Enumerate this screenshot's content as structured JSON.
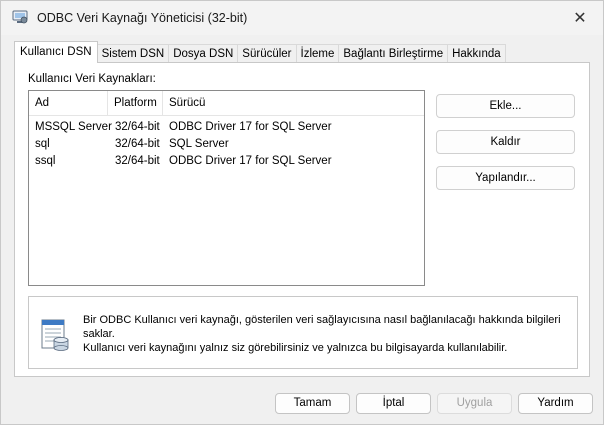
{
  "window": {
    "title": "ODBC Veri Kaynağı Yöneticisi (32-bit)",
    "close_glyph": "✕",
    "background_fragments": [
      "3",
      "Y"
    ]
  },
  "tabs": [
    {
      "label": "Kullanıcı DSN",
      "active": true
    },
    {
      "label": "Sistem DSN",
      "active": false
    },
    {
      "label": "Dosya DSN",
      "active": false
    },
    {
      "label": "Sürücüler",
      "active": false
    },
    {
      "label": "İzleme",
      "active": false
    },
    {
      "label": "Bağlantı Birleştirme",
      "active": false
    },
    {
      "label": "Hakkında",
      "active": false
    }
  ],
  "user_dsn": {
    "section_label": "Kullanıcı Veri Kaynakları:",
    "columns": [
      "Ad",
      "Platform",
      "Sürücü"
    ],
    "rows": [
      {
        "name": "MSSQL Server",
        "platform": "32/64-bit",
        "driver": "ODBC Driver 17 for SQL Server"
      },
      {
        "name": "sql",
        "platform": "32/64-bit",
        "driver": "SQL Server"
      },
      {
        "name": "ssql",
        "platform": "32/64-bit",
        "driver": "ODBC Driver 17 for SQL Server"
      }
    ],
    "buttons": {
      "add": "Ekle...",
      "remove": "Kaldır",
      "configure": "Yapılandır..."
    },
    "info": {
      "line1": "Bir ODBC Kullanıcı veri kaynağı, gösterilen veri sağlayıcısına nasıl bağlanılacağı hakkında bilgileri saklar.",
      "line2": "Kullanıcı veri kaynağını yalnız siz görebilirsiniz ve yalnızca bu bilgisayarda kullanılabilir."
    }
  },
  "footer": {
    "ok": "Tamam",
    "cancel": "İptal",
    "apply": "Uygula",
    "help": "Yardım"
  },
  "icons": {
    "app": "odbc-app-icon",
    "info": "data-source-info-icon",
    "close": "close-icon"
  }
}
